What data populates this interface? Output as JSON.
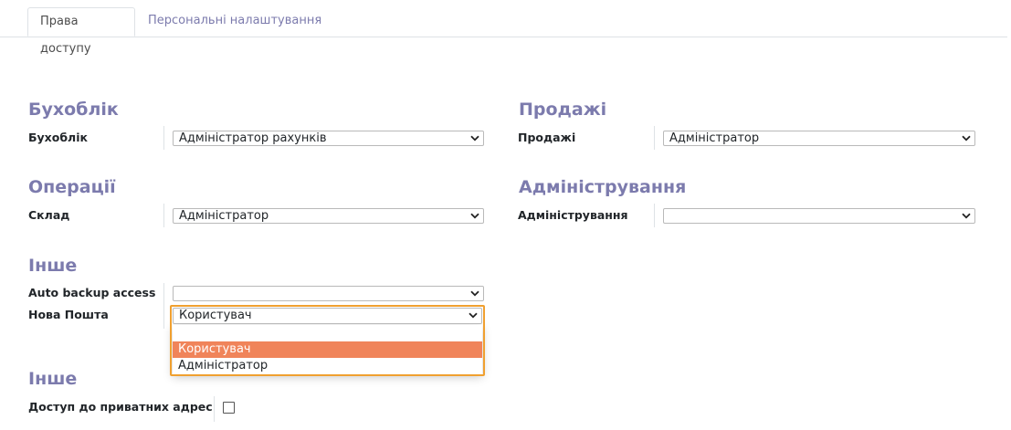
{
  "tabs": [
    {
      "label": "Права доступу",
      "active": true
    },
    {
      "label": "Персональні налаштування",
      "active": false
    }
  ],
  "sections": {
    "accounting": {
      "title": "Бухоблік",
      "field_label": "Бухоблік",
      "value": "Адміністратор рахунків"
    },
    "sales": {
      "title": "Продажі",
      "field_label": "Продажі",
      "value": "Адміністратор"
    },
    "operations": {
      "title": "Операції",
      "field_label": "Склад",
      "value": "Адміністратор"
    },
    "administration": {
      "title": "Адміністрування",
      "field_label": "Адміністрування",
      "value": ""
    },
    "other": {
      "title": "Інше",
      "backup_label": "Auto backup access",
      "backup_value": "",
      "nova_label": "Нова Пошта",
      "nova_value": "Користувач"
    },
    "other2": {
      "title": "Інше",
      "private_label": "Доступ до приватних адрес",
      "private_checked": false
    }
  },
  "dropdown": {
    "options": [
      "",
      "Користувач",
      "Адміністратор"
    ],
    "highlighted": "Користувач"
  },
  "colors": {
    "accent": "#7c7bad",
    "highlight": "#f0845a",
    "focus_border": "#f0a030"
  }
}
